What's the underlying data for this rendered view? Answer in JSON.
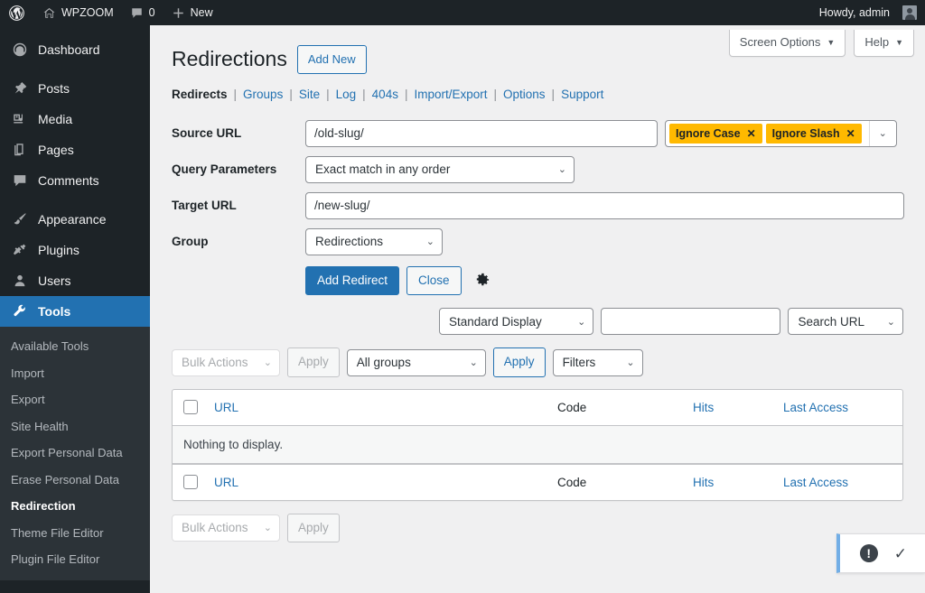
{
  "adminbar": {
    "logo_icon": "wordpress-logo-icon",
    "site_name": "WPZOOM",
    "home_icon": "home-icon",
    "comments_icon": "comment-bubble-icon",
    "comment_count": "0",
    "new_icon": "plus-icon",
    "new_label": "New",
    "howdy": "Howdy, admin",
    "avatar_icon": "avatar-icon"
  },
  "sidebar": {
    "items": [
      {
        "label": "Dashboard",
        "icon": "dashboard-icon",
        "active": false
      },
      {
        "label": "Posts",
        "icon": "pin-icon",
        "active": false
      },
      {
        "label": "Media",
        "icon": "media-icon",
        "active": false
      },
      {
        "label": "Pages",
        "icon": "pages-icon",
        "active": false
      },
      {
        "label": "Comments",
        "icon": "comments-icon",
        "active": false
      },
      {
        "label": "Appearance",
        "icon": "brush-icon",
        "active": false
      },
      {
        "label": "Plugins",
        "icon": "plug-icon",
        "active": false
      },
      {
        "label": "Users",
        "icon": "user-icon",
        "active": false
      },
      {
        "label": "Tools",
        "icon": "wrench-icon",
        "active": true
      }
    ],
    "submenu": [
      {
        "label": "Available Tools",
        "current": false
      },
      {
        "label": "Import",
        "current": false
      },
      {
        "label": "Export",
        "current": false
      },
      {
        "label": "Site Health",
        "current": false
      },
      {
        "label": "Export Personal Data",
        "current": false
      },
      {
        "label": "Erase Personal Data",
        "current": false
      },
      {
        "label": "Redirection",
        "current": true
      },
      {
        "label": "Theme File Editor",
        "current": false
      },
      {
        "label": "Plugin File Editor",
        "current": false
      }
    ]
  },
  "screen_meta": {
    "screen_options": "Screen Options",
    "help": "Help",
    "caret": "▼"
  },
  "header": {
    "title": "Redirections",
    "add_new": "Add New"
  },
  "subnav": {
    "sep": "|",
    "items": [
      {
        "label": "Redirects",
        "current": true
      },
      {
        "label": "Groups",
        "current": false
      },
      {
        "label": "Site",
        "current": false
      },
      {
        "label": "Log",
        "current": false
      },
      {
        "label": "404s",
        "current": false
      },
      {
        "label": "Import/Export",
        "current": false
      },
      {
        "label": "Options",
        "current": false
      },
      {
        "label": "Support",
        "current": false
      }
    ]
  },
  "form": {
    "source_url": {
      "label": "Source URL",
      "value": "/old-slug/",
      "placeholder": "",
      "flags": [
        {
          "label": "Ignore Case",
          "remove": "✕"
        },
        {
          "label": "Ignore Slash",
          "remove": "✕"
        }
      ],
      "flag_caret": "⌄",
      "flag_color": "#ffb900"
    },
    "query_params": {
      "label": "Query Parameters",
      "value": "Exact match in any order",
      "caret": "⌄"
    },
    "target_url": {
      "label": "Target URL",
      "value": "/new-slug/",
      "placeholder": ""
    },
    "group": {
      "label": "Group",
      "value": "Redirections",
      "caret": "⌄"
    },
    "actions": {
      "add_redirect": "Add Redirect",
      "close": "Close",
      "settings_icon": "gear-icon"
    }
  },
  "display_bar": {
    "display_mode": "Standard Display",
    "display_caret": "⌄",
    "search_value": "",
    "search_placeholder": "",
    "search_scope": "Search URL",
    "scope_caret": "⌄"
  },
  "filter_bar": {
    "bulk_actions": "Bulk Actions",
    "bulk_caret": "⌄",
    "apply_disabled": "Apply",
    "group_filter": "All groups",
    "group_caret": "⌄",
    "apply_active": "Apply",
    "filters": "Filters",
    "filters_caret": "⌄"
  },
  "table": {
    "columns": {
      "url": "URL",
      "code": "Code",
      "hits": "Hits",
      "last_access": "Last Access"
    },
    "rows": [],
    "empty_message": "Nothing to display."
  },
  "bottom_bar": {
    "bulk_actions": "Bulk Actions",
    "bulk_caret": "⌄",
    "apply": "Apply"
  },
  "status_dock": {
    "alert_icon": "exclamation-circle-icon",
    "alert_glyph": "!",
    "check_icon": "check-icon",
    "check_glyph": "✓",
    "accent_color": "#72aee6"
  }
}
